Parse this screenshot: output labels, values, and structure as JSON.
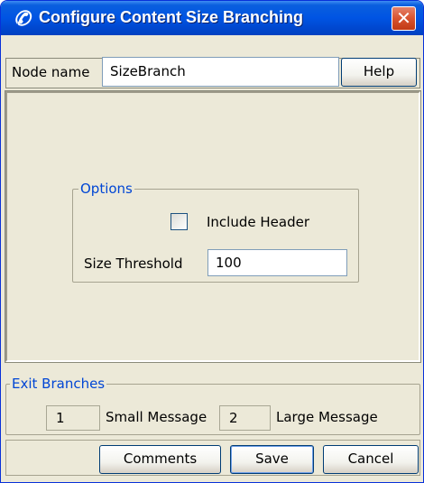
{
  "window": {
    "title": "Configure Content Size Branching",
    "title_icon": "phone-handset-icon",
    "close_icon": "close-icon",
    "close_symbol": "✕"
  },
  "node": {
    "label": "Node name",
    "value": "SizeBranch",
    "help_label": "Help"
  },
  "options": {
    "legend": "Options",
    "include_header_label": "Include Header",
    "include_header_checked": false,
    "size_threshold_label": "Size Threshold",
    "size_threshold_value": "100"
  },
  "exit_branches": {
    "legend": "Exit Branches",
    "items": [
      {
        "number": "1",
        "label": "Small Message"
      },
      {
        "number": "2",
        "label": "Large Message"
      }
    ]
  },
  "buttons": {
    "comments": "Comments",
    "save": "Save",
    "cancel": "Cancel"
  },
  "colors": {
    "titlebar": "#0054e3",
    "dialog_bg": "#ece9d8",
    "legend_text": "#0046d5",
    "close_button": "#d8532f"
  }
}
